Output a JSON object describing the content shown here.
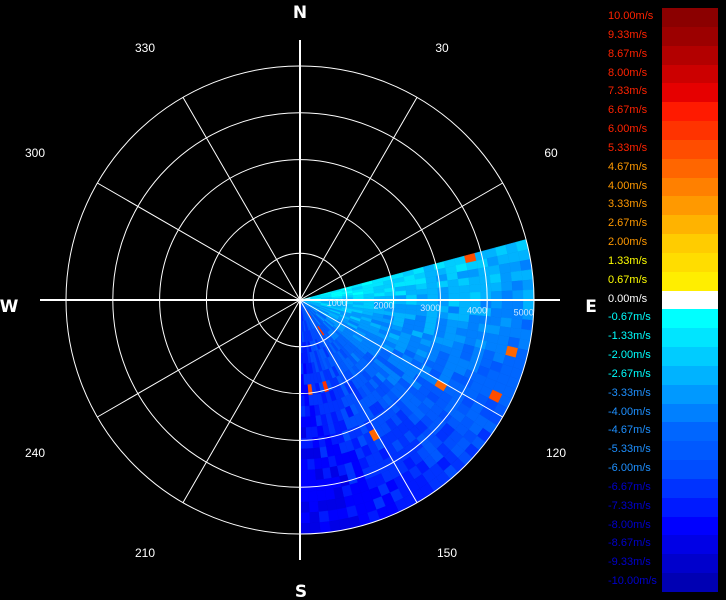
{
  "chart_data": {
    "type": "polar-radar",
    "cardinals": [
      "N",
      "E",
      "S",
      "W"
    ],
    "degree_labels": [
      "30",
      "60",
      "120",
      "150",
      "210",
      "240",
      "300",
      "330"
    ],
    "range_labels": [
      "1000",
      "2000",
      "3000",
      "4000",
      "5000"
    ],
    "range_label_bearing_deg": 93,
    "max_range": 5000,
    "ring_count": 5,
    "spokes_deg": [
      0,
      30,
      60,
      90,
      120,
      150,
      180,
      210,
      240,
      270,
      300,
      330
    ],
    "data_sector_deg": [
      75,
      180
    ],
    "velocity_unit": "m/s",
    "velocity_min": -10,
    "velocity_max": 10,
    "legend": {
      "placement": "right",
      "entries": [
        {
          "label": "10.00m/s",
          "color": "#8b0000"
        },
        {
          "label": "9.33m/s",
          "color": "#9c0000"
        },
        {
          "label": "8.67m/s",
          "color": "#b30000"
        },
        {
          "label": "8.00m/s",
          "color": "#cc0000"
        },
        {
          "label": "7.33m/s",
          "color": "#e60000"
        },
        {
          "label": "6.67m/s",
          "color": "#ff1a00"
        },
        {
          "label": "6.00m/s",
          "color": "#ff3300"
        },
        {
          "label": "5.33m/s",
          "color": "#ff4d00"
        },
        {
          "label": "4.67m/s",
          "color": "#ff6600"
        },
        {
          "label": "4.00m/s",
          "color": "#ff8000"
        },
        {
          "label": "3.33m/s",
          "color": "#ff9900"
        },
        {
          "label": "2.67m/s",
          "color": "#ffb300"
        },
        {
          "label": "2.00m/s",
          "color": "#ffcc00"
        },
        {
          "label": "1.33m/s",
          "color": "#ffdd00"
        },
        {
          "label": "0.67m/s",
          "color": "#ffee00"
        },
        {
          "label": "0.00m/s",
          "color": "#ffffff"
        },
        {
          "label": "-0.67m/s",
          "color": "#00ffff"
        },
        {
          "label": "-1.33m/s",
          "color": "#00e5ff"
        },
        {
          "label": "-2.00m/s",
          "color": "#00ccff"
        },
        {
          "label": "-2.67m/s",
          "color": "#00b3ff"
        },
        {
          "label": "-3.33m/s",
          "color": "#0099ff"
        },
        {
          "label": "-4.00m/s",
          "color": "#0080ff"
        },
        {
          "label": "-4.67m/s",
          "color": "#0066ff"
        },
        {
          "label": "-5.33m/s",
          "color": "#0059ff"
        },
        {
          "label": "-6.00m/s",
          "color": "#004dff"
        },
        {
          "label": "-6.67m/s",
          "color": "#0033ff"
        },
        {
          "label": "-7.33m/s",
          "color": "#001aff"
        },
        {
          "label": "-8.00m/s",
          "color": "#0000ff"
        },
        {
          "label": "-8.67m/s",
          "color": "#0000e6"
        },
        {
          "label": "-9.33m/s",
          "color": "#0000cc"
        },
        {
          "label": "-10.00m/s",
          "color": "#0000b3"
        }
      ]
    },
    "label_colors": {
      "positive_low": "#ffff00",
      "positive_mid": "#ff9900",
      "positive_high": "#ff2200",
      "zero": "#ffffff",
      "negative_low": "#00ffff",
      "negative_mid": "#1e90ff",
      "negative_high": "#0000cd"
    }
  }
}
